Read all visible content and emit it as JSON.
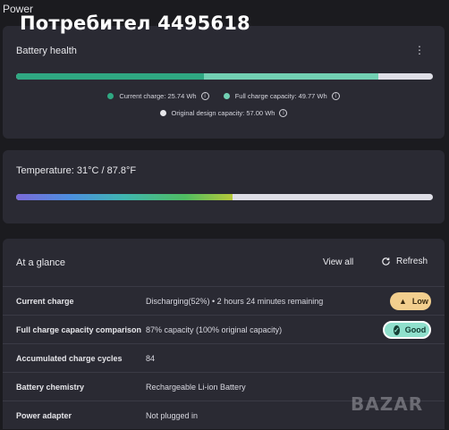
{
  "app_title": "Power",
  "overlay_title": "Потребител 4495618",
  "battery_health": {
    "title": "Battery health",
    "more_label": "⋮",
    "current_charge_fraction": 0.45,
    "full_capacity_fraction": 0.87,
    "legend": {
      "current": {
        "label": "Current charge: 25.74 Wh",
        "color": "#2fa882"
      },
      "full": {
        "label": "Full charge capacity: 49.77 Wh",
        "color": "#72d0b3"
      },
      "design": {
        "label": "Original design capacity: 57.00 Wh",
        "color": "#e6e6ea"
      }
    }
  },
  "temperature": {
    "label": "Temperature:  31°C / 87.8°F",
    "fill_fraction": 0.52
  },
  "glance": {
    "title": "At a glance",
    "view_all": "View all",
    "refresh": "Refresh",
    "rows": [
      {
        "label": "Current charge",
        "value": "Discharging(52%)  •  2 hours 24 minutes remaining",
        "badge": "Low"
      },
      {
        "label": "Full charge capacity comparison",
        "value": "87% capacity (100% original capacity)",
        "badge": "Good"
      },
      {
        "label": "Accumulated charge cycles",
        "value": "84"
      },
      {
        "label": "Battery chemistry",
        "value": "Rechargeable Li-ion Battery"
      },
      {
        "label": "Power adapter",
        "value": "Not plugged in"
      }
    ]
  },
  "watermark": "BAZAR"
}
